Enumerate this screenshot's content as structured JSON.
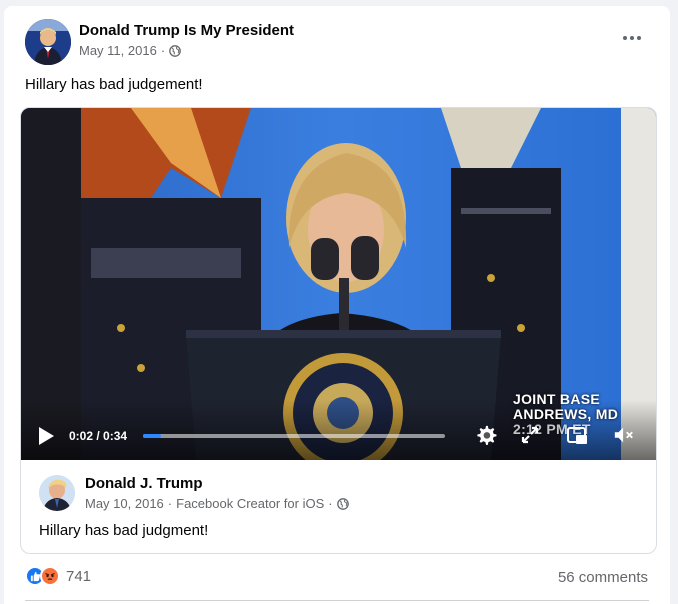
{
  "post": {
    "author": "Donald Trump Is My President",
    "date": "May 11, 2016",
    "separator": "·",
    "privacy_icon": "globe-icon",
    "text": "Hillary has bad judgement!",
    "more_icon": "more-options-icon"
  },
  "video": {
    "time": "0:02 / 0:34",
    "progress": 0.06,
    "chyron_line1": "JOINT BASE",
    "chyron_line2": "ANDREWS, MD",
    "chyron_line3": "2:12 PM ET",
    "icons": [
      "play-icon",
      "settings-icon",
      "fullscreen-icon",
      "picture-in-picture-icon",
      "mute-icon"
    ]
  },
  "shared": {
    "author": "Donald J. Trump",
    "date": "May 10, 2016",
    "separator": "·",
    "source": "Facebook Creator for iOS",
    "separator2": "·",
    "text": "Hillary has bad judgment!"
  },
  "footer": {
    "reaction_count": "741",
    "comments": "56 comments"
  },
  "colors": {
    "accent": "#2d88ff",
    "like": "#1877f2",
    "angry": "#f7713c",
    "muted_text": "#65676b"
  }
}
